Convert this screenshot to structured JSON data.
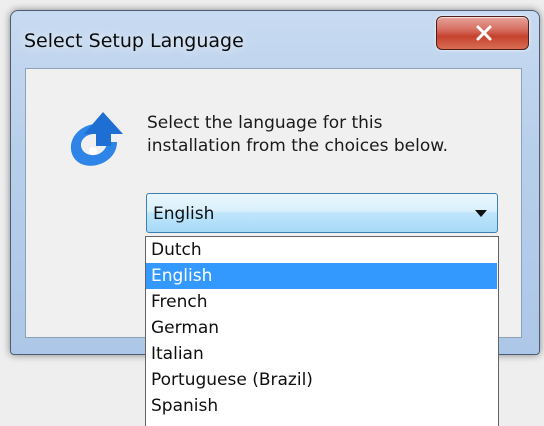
{
  "window": {
    "title": "Select Setup Language",
    "close_glyph": "X"
  },
  "prompt": {
    "line1": "Select the language for this",
    "line2": "installation from the choices below."
  },
  "language_select": {
    "selected": "English"
  },
  "dropdown": {
    "options": [
      "Dutch",
      "English",
      "French",
      "German",
      "Italian",
      "Portuguese (Brazil)",
      "Spanish"
    ],
    "highlighted": "English"
  },
  "icons": {
    "setup": "setup-arrow-icon",
    "close": "close-icon",
    "dropdown": "chevron-down-icon"
  },
  "colors": {
    "selection": "#3399ff",
    "close_button": "#c7432f",
    "icon_blue": "#2b7fe6"
  }
}
